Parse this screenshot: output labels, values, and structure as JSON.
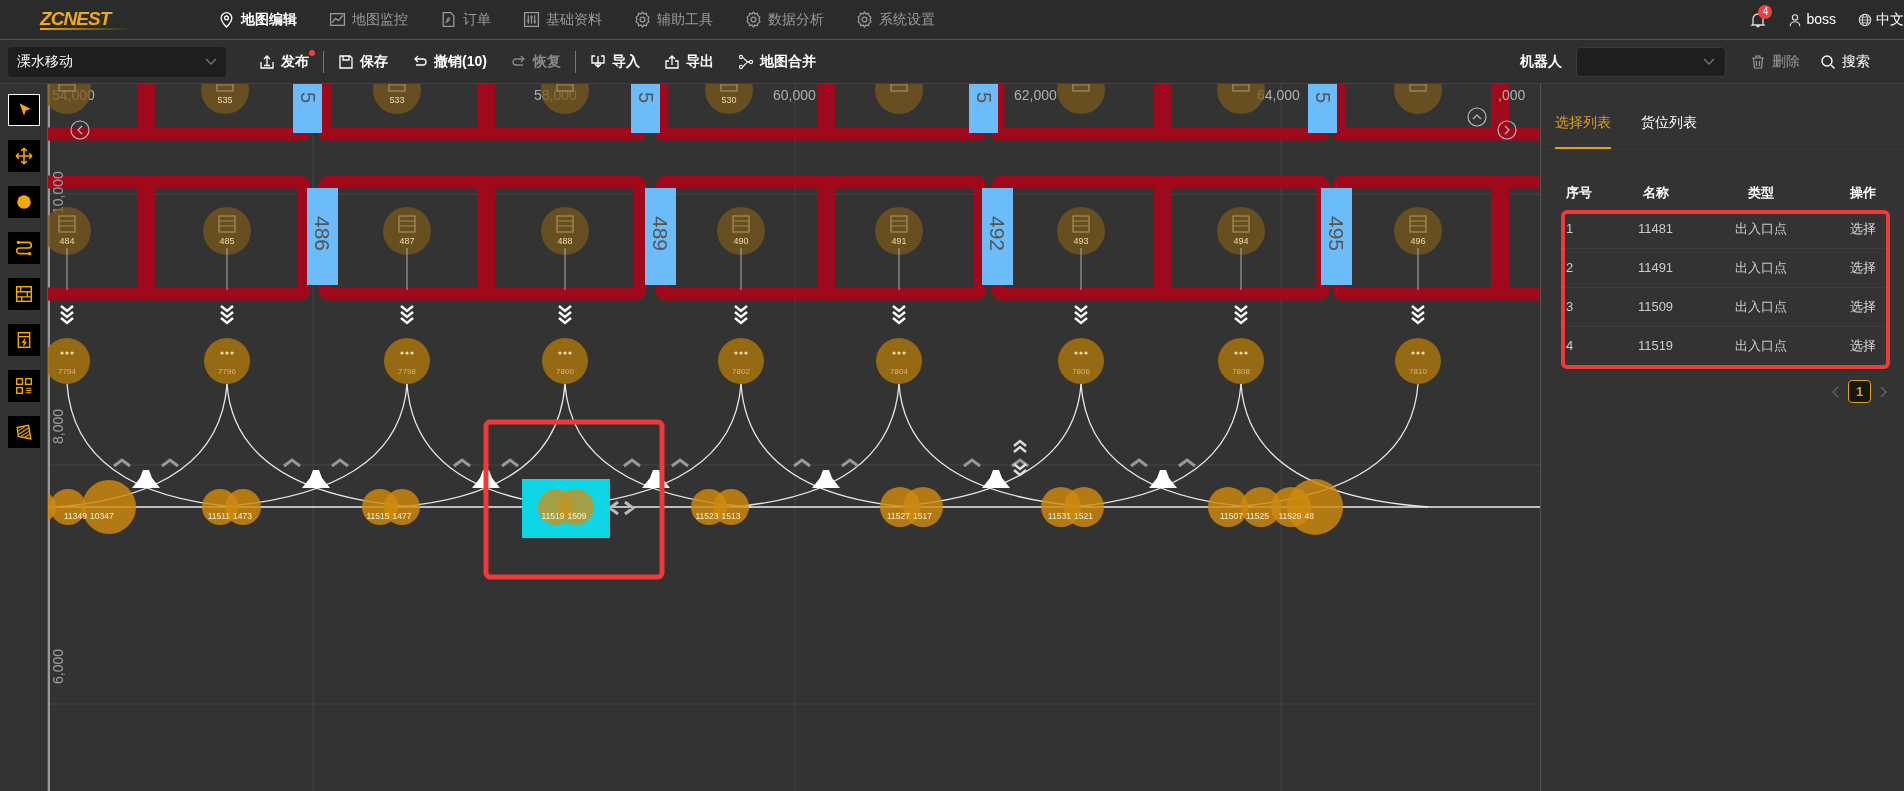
{
  "app": {
    "logo": "ZCNEST"
  },
  "nav": [
    {
      "label": "地图编辑",
      "selected": true
    },
    {
      "label": "地图监控",
      "selected": false
    },
    {
      "label": "订单",
      "selected": false
    },
    {
      "label": "基础资料",
      "selected": false
    },
    {
      "label": "辅助工具",
      "selected": false
    },
    {
      "label": "数据分析",
      "selected": false
    },
    {
      "label": "系统设置",
      "selected": false
    }
  ],
  "header_right": {
    "notifications": "4",
    "user": "boss",
    "language": "中文"
  },
  "toolbar": {
    "map_select": "溧水移动",
    "actions": [
      {
        "label": "发布",
        "disabled": false,
        "dot": true
      },
      {
        "label": "保存",
        "disabled": false,
        "dot": false
      },
      {
        "label": "撤销(10)",
        "disabled": false,
        "dot": false
      },
      {
        "label": "恢复",
        "disabled": true,
        "dot": false
      },
      {
        "label": "导入",
        "disabled": false,
        "dot": false
      },
      {
        "label": "导出",
        "disabled": false,
        "dot": false
      },
      {
        "label": "地图合并",
        "disabled": false,
        "dot": false
      }
    ],
    "robot_label": "机器人",
    "right_actions": [
      {
        "label": "删除",
        "disabled": true
      },
      {
        "label": "搜索",
        "disabled": false
      }
    ]
  },
  "tools": [
    {
      "selected": true
    },
    {
      "selected": false
    },
    {
      "selected": false
    },
    {
      "selected": false
    },
    {
      "selected": false
    },
    {
      "selected": false
    },
    {
      "selected": false
    },
    {
      "selected": false
    }
  ],
  "map": {
    "x_axis_labels": [
      "54,000",
      "58,000",
      "60,000",
      "62,000",
      "64,000",
      ",000"
    ],
    "y_axis_labels": [
      "10,000",
      "8,000",
      "6,000"
    ],
    "top_markers": [
      "5",
      "5",
      "5",
      "5"
    ],
    "markers": [
      "486",
      "489",
      "492",
      "495"
    ],
    "top_rack_labels": [
      "535",
      "533",
      "530"
    ],
    "rack_nodes": [
      "484",
      "485",
      "487",
      "488",
      "490",
      "491",
      "493",
      "494",
      "496"
    ],
    "path_nodes": [
      "7794",
      "7796",
      "7798",
      "7800",
      "7802",
      "7804",
      "7806",
      "7808",
      "7810"
    ],
    "points": [
      {
        "label": "11349",
        "selected": false
      },
      {
        "label": "10347",
        "selected": false
      },
      {
        "label": "11511",
        "selected": false
      },
      {
        "label": "1473",
        "selected": false
      },
      {
        "label": "11515",
        "selected": false
      },
      {
        "label": "1477",
        "selected": false
      },
      {
        "label": "11519",
        "selected": true
      },
      {
        "label": "1509",
        "selected": true
      },
      {
        "label": "11523",
        "selected": false
      },
      {
        "label": "1513",
        "selected": false
      },
      {
        "label": "11527",
        "selected": false
      },
      {
        "label": "1517",
        "selected": false
      },
      {
        "label": "11531",
        "selected": false
      },
      {
        "label": "1521",
        "selected": false
      },
      {
        "label": "11507",
        "selected": false
      },
      {
        "label": "11525",
        "selected": false
      },
      {
        "label": "11529",
        "selected": false
      },
      {
        "label": "48",
        "selected": false
      }
    ]
  },
  "panel": {
    "tabs": [
      {
        "label": "选择列表",
        "selected": true
      },
      {
        "label": "货位列表",
        "selected": false
      }
    ],
    "columns": [
      "序号",
      "名称",
      "类型",
      "操作"
    ],
    "rows": [
      [
        "1",
        "11481",
        "出入口点",
        "选择"
      ],
      [
        "2",
        "11491",
        "出入口点",
        "选择"
      ],
      [
        "3",
        "11509",
        "出入口点",
        "选择"
      ],
      [
        "4",
        "11519",
        "出入口点",
        "选择"
      ]
    ],
    "pages": [
      {
        "label": "1",
        "selected": true
      }
    ]
  }
}
